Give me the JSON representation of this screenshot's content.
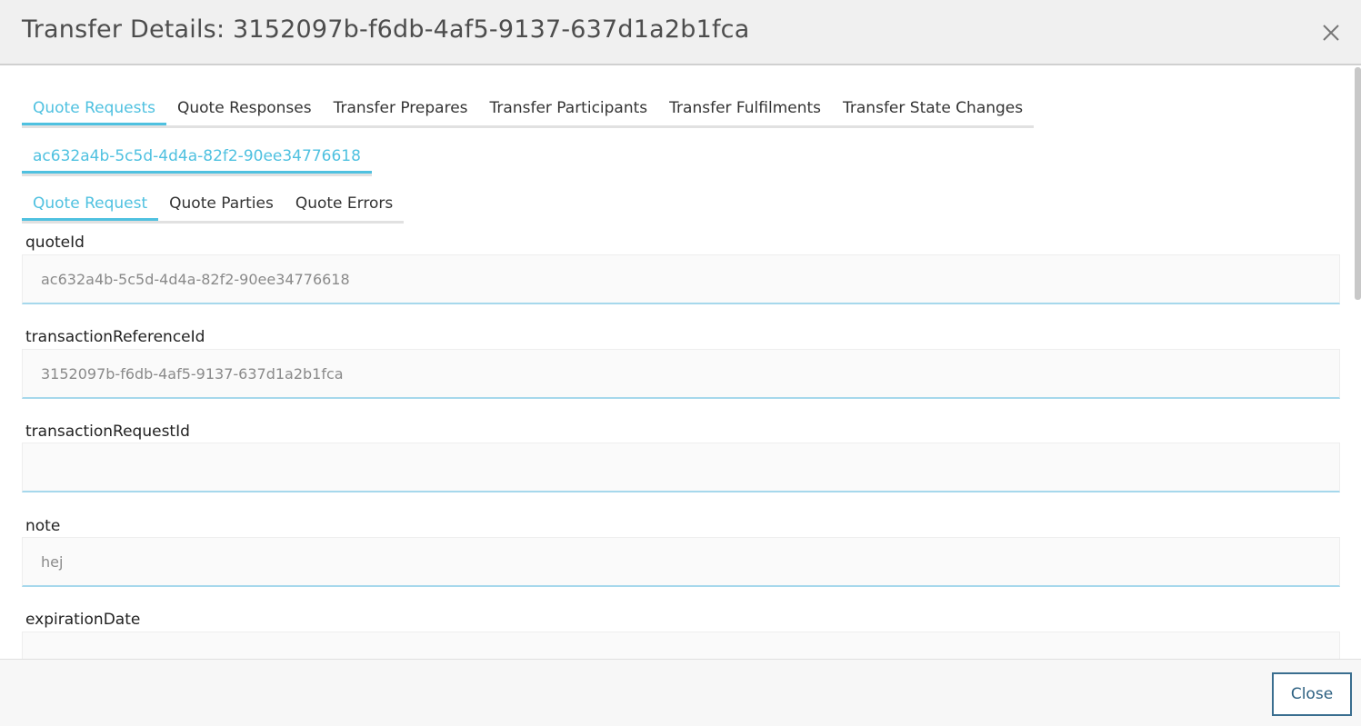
{
  "modal": {
    "title": "Transfer Details: 3152097b-f6db-4af5-9137-637d1a2b1fca",
    "close_label": "Close"
  },
  "main_tabs": [
    {
      "label": "Quote Requests",
      "active": true
    },
    {
      "label": "Quote Responses",
      "active": false
    },
    {
      "label": "Transfer Prepares",
      "active": false
    },
    {
      "label": "Transfer Participants",
      "active": false
    },
    {
      "label": "Transfer Fulfilments",
      "active": false
    },
    {
      "label": "Transfer State Changes",
      "active": false
    }
  ],
  "quote_tabs": [
    {
      "label": "ac632a4b-5c5d-4d4a-82f2-90ee34776618",
      "active": true
    }
  ],
  "sub_tabs": [
    {
      "label": "Quote Request",
      "active": true
    },
    {
      "label": "Quote Parties",
      "active": false
    },
    {
      "label": "Quote Errors",
      "active": false
    }
  ],
  "fields": [
    {
      "label": "quoteId",
      "value": "ac632a4b-5c5d-4d4a-82f2-90ee34776618"
    },
    {
      "label": "transactionReferenceId",
      "value": "3152097b-f6db-4af5-9137-637d1a2b1fca"
    },
    {
      "label": "transactionRequestId",
      "value": ""
    },
    {
      "label": "note",
      "value": "hej"
    },
    {
      "label": "expirationDate",
      "value": ""
    }
  ],
  "colors": {
    "accent": "#4fc1e0",
    "button_border": "#3a6e8f"
  }
}
